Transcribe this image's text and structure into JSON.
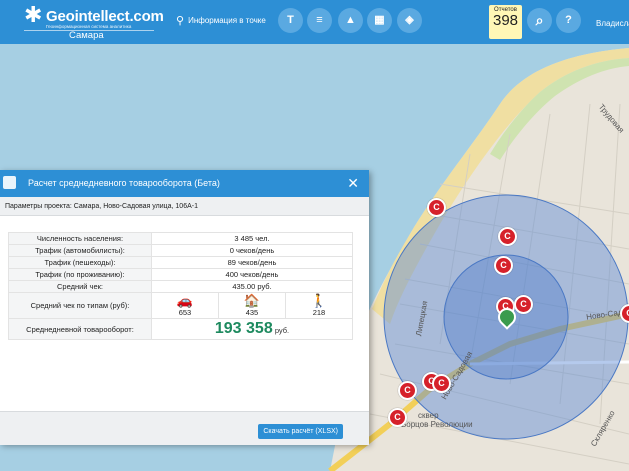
{
  "header": {
    "logo_title": "Geointellect",
    "logo_tld": ".com",
    "logo_sub": "Геоинформационная система аналитика",
    "city": "Самара",
    "location_label": "Информация в точке",
    "tools": [
      {
        "name": "typography-icon",
        "glyph": "T"
      },
      {
        "name": "database-icon",
        "glyph": "≡"
      },
      {
        "name": "graduation-cap-icon",
        "glyph": "▲"
      },
      {
        "name": "buildings-icon",
        "glyph": "▦"
      },
      {
        "name": "layers-icon",
        "glyph": "◈"
      }
    ],
    "reports_label": "Отчетов",
    "reports_count": "398",
    "search_glyph": "⌕",
    "help_glyph": "?",
    "user_label": "Владисла"
  },
  "map": {
    "labels": [
      "Трудовая",
      "Липецкая",
      "Ново-Садовая",
      "Ново-Садовая",
      "сквер",
      "Борцов Революции",
      "Скляренко"
    ],
    "poi_glyph": "C"
  },
  "panel": {
    "title": "Расчет среднедневного товарооборота (Бета)",
    "params": "Параметры проекта: Самара, Ново-Садовая улица, 106А-1",
    "rows": [
      {
        "key": "Численность населения:",
        "value": "3 485 чел."
      },
      {
        "key": "Трафик (автомобилисты):",
        "value": "0 чеков/день"
      },
      {
        "key": "Трафик (пешеходы):",
        "value": "89 чеков/день"
      },
      {
        "key": "Трафик (по проживанию):",
        "value": "400 чеков/день"
      },
      {
        "key": "Средний чек:",
        "value": "435.00 руб."
      }
    ],
    "by_type_label": "Средний чек по типам (руб):",
    "by_type": [
      {
        "icon": "car-icon",
        "glyph": "🚗",
        "value": "653"
      },
      {
        "icon": "house-icon",
        "glyph": "🏠",
        "value": "435"
      },
      {
        "icon": "pedestrian-icon",
        "glyph": "🚶",
        "value": "218"
      }
    ],
    "total_label": "Среднедневной товарооборот:",
    "total_value": "193 358",
    "total_unit": "руб.",
    "download_label": "Скачать расчёт (XLSX)",
    "close_glyph": "✕"
  },
  "colors": {
    "header": "#2d8fd5",
    "total": "#1e8a5f",
    "poi": "#d6212a",
    "river": "#a6cfe3",
    "buffer": "#5b8ad6"
  }
}
